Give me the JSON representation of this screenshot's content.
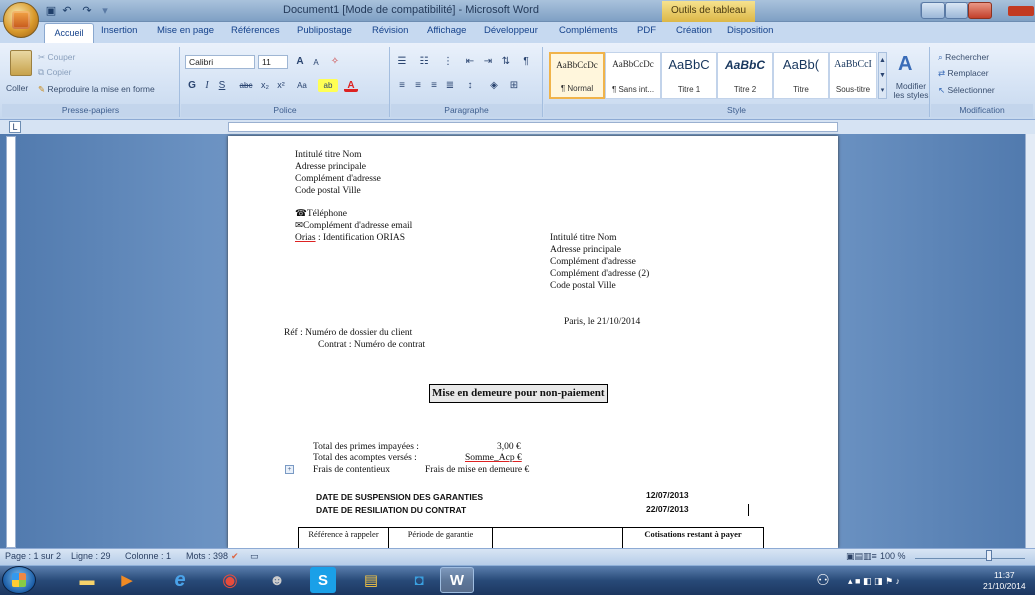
{
  "window": {
    "title": "Document1 [Mode de compatibilité] - Microsoft Word",
    "tool_tab": "Outils de tableau"
  },
  "tabs": [
    "Accueil",
    "Insertion",
    "Mise en page",
    "Références",
    "Publipostage",
    "Révision",
    "Affichage",
    "Développeur",
    "Compléments",
    "PDF",
    "Création",
    "Disposition"
  ],
  "ribbon": {
    "clipboard": {
      "paste": "Coller",
      "cut": "Couper",
      "copy": "Copier",
      "format_painter": "Reproduire la mise en forme",
      "label": "Presse-papiers"
    },
    "font": {
      "name": "Calibri",
      "size": "11",
      "label": "Police"
    },
    "paragraph": {
      "label": "Paragraphe"
    },
    "styles": {
      "items": [
        {
          "preview": "AaBbCcDc",
          "name": "¶ Normal"
        },
        {
          "preview": "AaBbCcDc",
          "name": "¶ Sans int..."
        },
        {
          "preview": "AaBbC",
          "name": "Titre 1"
        },
        {
          "preview": "AaBbC",
          "name": "Titre 2"
        },
        {
          "preview": "AaBb(",
          "name": "Titre"
        },
        {
          "preview": "AaBbCcI",
          "name": "Sous-titre"
        }
      ],
      "modify": "Modifier les styles",
      "label": "Style"
    },
    "editing": {
      "find": "Rechercher",
      "replace": "Remplacer",
      "select": "Sélectionner",
      "label": "Modification"
    }
  },
  "document": {
    "sender": [
      "Intitulé titre Nom",
      "Adresse principale",
      "Complément d'adresse",
      "Code postal Ville"
    ],
    "phone": "Téléphone",
    "email": "Complément d'adresse email",
    "orias_label": "Orias",
    "orias_value": " : Identification ORIAS",
    "recipient": [
      "Intitulé titre Nom",
      "Adresse principale",
      "Complément d'adresse",
      "Complément d'adresse (2)",
      "Code postal Ville"
    ],
    "place_date": "Paris, le 21/10/2014",
    "ref1": "Réf : Numéro de dossier du client",
    "ref2": "Contrat : Numéro de contrat",
    "title": "Mise en demeure pour non-paiement",
    "unpaid_label": "Total des primes impayées :",
    "unpaid_value": "3,00 €",
    "deposits_label": "Total des acomptes versés :",
    "deposits_value": "Somme_Acp €",
    "fees_label": "Frais de contentieux",
    "fees_value": "Frais de mise en demeure  €",
    "suspension_label": "DATE DE SUSPENSION DES GARANTIES",
    "suspension_date": "12/07/2013",
    "termination_label": "DATE DE RESILIATION DU CONTRAT",
    "termination_date": "22/07/2013",
    "table_headers": [
      "Référence à rappeler",
      "Période de garantie",
      "",
      "Cotisations restant à payer"
    ]
  },
  "status": {
    "page": "Page : 1 sur 2",
    "line": "Ligne : 29",
    "column": "Colonne : 1",
    "words": "Mots : 398",
    "zoom": "100 %"
  },
  "clock": {
    "time": "11:37",
    "date": "21/10/2014"
  }
}
